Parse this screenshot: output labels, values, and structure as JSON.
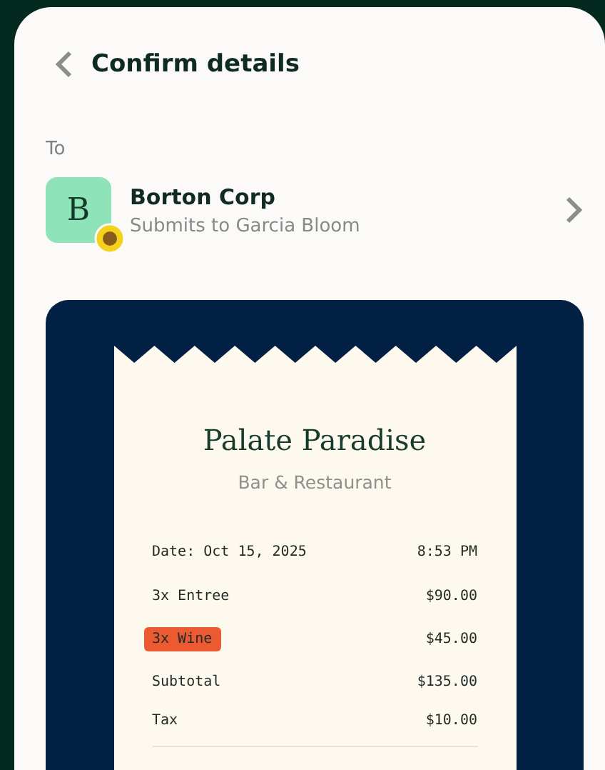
{
  "header": {
    "title": "Confirm details"
  },
  "recipient": {
    "label": "To",
    "initial": "B",
    "name": "Borton Corp",
    "subtitle": "Submits to Garcia Bloom"
  },
  "receipt": {
    "merchant": "Palate Paradise",
    "category": "Bar & Restaurant",
    "date": "Date: Oct 15, 2025",
    "time": "8:53 PM",
    "lines": [
      {
        "label": "3x Entree",
        "amount": "$90.00",
        "highlighted": false
      },
      {
        "label": "3x Wine",
        "amount": "$45.00",
        "highlighted": true
      },
      {
        "label": "Subtotal",
        "amount": "$135.00",
        "highlighted": false
      },
      {
        "label": "Tax",
        "amount": "$10.00",
        "highlighted": false
      }
    ]
  }
}
